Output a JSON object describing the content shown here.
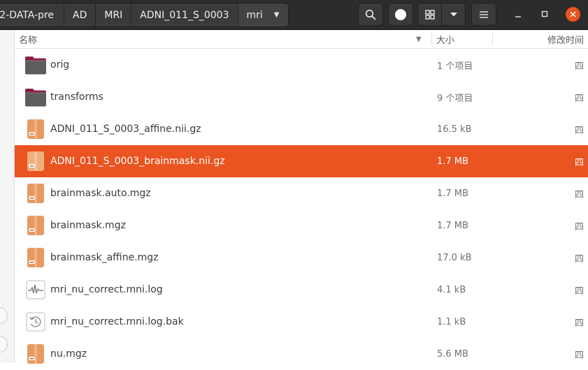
{
  "breadcrumbs": [
    {
      "label": "2-DATA-pre"
    },
    {
      "label": "AD"
    },
    {
      "label": "MRI"
    },
    {
      "label": "ADNI_011_S_0003"
    },
    {
      "label": "mri"
    }
  ],
  "toolbar": {
    "search_icon": "search-icon",
    "circle_icon": "record-circle-icon",
    "view_icon": "grid-view-icon",
    "dropdown_icon": "chevron-down-icon",
    "menu_icon": "hamburger-menu-icon"
  },
  "window_controls": {
    "minimize": "–",
    "maximize": "□",
    "close": "×"
  },
  "columns": {
    "name": "名称",
    "size": "大小",
    "modified": "修改时间"
  },
  "files": [
    {
      "name": "orig",
      "size": "1 个项目",
      "modified": "四",
      "icon": "folder-icon",
      "selected": false
    },
    {
      "name": "transforms",
      "size": "9 个项目",
      "modified": "四",
      "icon": "folder-icon",
      "selected": false
    },
    {
      "name": "ADNI_011_S_0003_affine.nii.gz",
      "size": "16.5 kB",
      "modified": "四",
      "icon": "archive-icon",
      "selected": false
    },
    {
      "name": "ADNI_011_S_0003_brainmask.nii.gz",
      "size": "1.7 MB",
      "modified": "四",
      "icon": "archive-icon",
      "selected": true
    },
    {
      "name": "brainmask.auto.mgz",
      "size": "1.7 MB",
      "modified": "四",
      "icon": "archive-icon",
      "selected": false
    },
    {
      "name": "brainmask.mgz",
      "size": "1.7 MB",
      "modified": "四",
      "icon": "archive-icon",
      "selected": false
    },
    {
      "name": "brainmask_affine.mgz",
      "size": "17.0 kB",
      "modified": "四",
      "icon": "archive-icon",
      "selected": false
    },
    {
      "name": "mri_nu_correct.mni.log",
      "size": "4.1 kB",
      "modified": "四",
      "icon": "log-file-icon",
      "selected": false
    },
    {
      "name": "mri_nu_correct.mni.log.bak",
      "size": "1.1 kB",
      "modified": "四",
      "icon": "backup-file-icon",
      "selected": false
    },
    {
      "name": "nu.mgz",
      "size": "5.6 MB",
      "modified": "四",
      "icon": "archive-icon",
      "selected": false
    }
  ],
  "colors": {
    "accent": "#e95420",
    "headerbar": "#2c2c2c",
    "folder": "#5d5d5d",
    "folder_tab": "#8a2140",
    "archive": "#e69a61"
  }
}
